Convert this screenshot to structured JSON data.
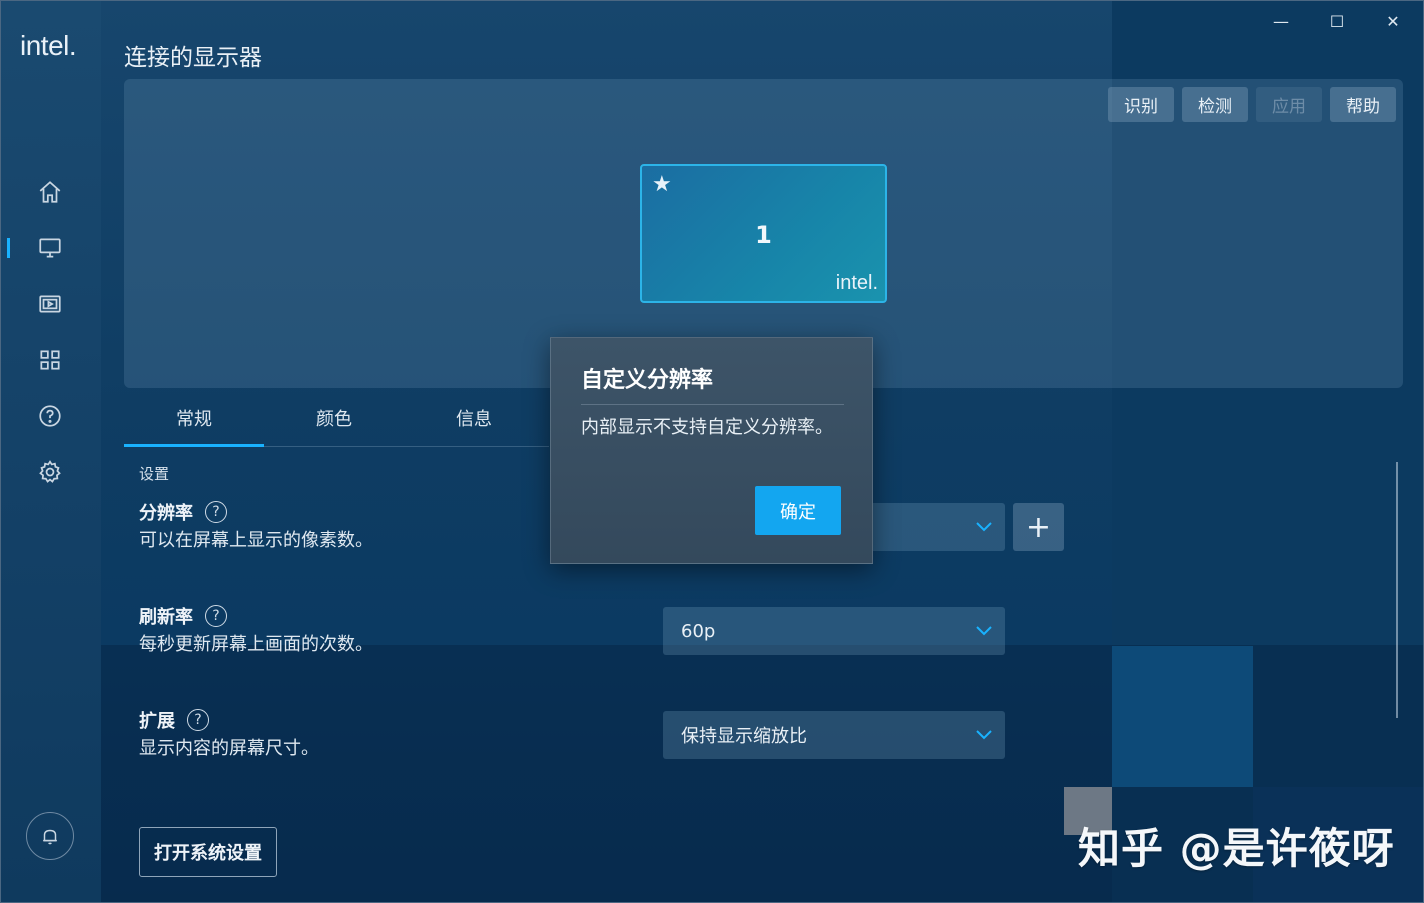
{
  "app": {
    "brand": "intel.",
    "page_title": "连接的显示器"
  },
  "window_controls": {
    "minimize": "—",
    "maximize": "☐",
    "close": "✕"
  },
  "sidebar": {
    "items": [
      {
        "name": "home-icon"
      },
      {
        "name": "display-icon",
        "active": true
      },
      {
        "name": "video-icon"
      },
      {
        "name": "apps-grid-icon"
      },
      {
        "name": "help-icon"
      },
      {
        "name": "settings-gear-icon"
      }
    ],
    "notification_icon": "bell-icon"
  },
  "toolbar": {
    "identify": "识别",
    "detect": "检测",
    "apply": "应用",
    "help": "帮助"
  },
  "monitor": {
    "number": "1",
    "brand": "intel.",
    "primary_star": "★"
  },
  "tabs": [
    {
      "label": "常规",
      "active": true
    },
    {
      "label": "颜色"
    },
    {
      "label": "信息"
    }
  ],
  "settings": {
    "section_label": "设置",
    "resolution": {
      "title": "分辨率",
      "desc": "可以在屏幕上显示的像素数。",
      "value": "",
      "add_button": "+"
    },
    "refresh": {
      "title": "刷新率",
      "desc": "每秒更新屏幕上画面的次数。",
      "value": "60p"
    },
    "scaling": {
      "title": "扩展",
      "desc": "显示内容的屏幕尺寸。",
      "value": "保持显示缩放比"
    },
    "help_mark": "?",
    "open_system_settings": "打开系统设置"
  },
  "dialog": {
    "title": "自定义分辨率",
    "message": "内部显示不支持自定义分辨率。",
    "ok": "确定"
  },
  "watermark": "知乎 @是许筱呀",
  "colors": {
    "accent": "#19b2ff",
    "ok_button": "#13a6f0"
  }
}
